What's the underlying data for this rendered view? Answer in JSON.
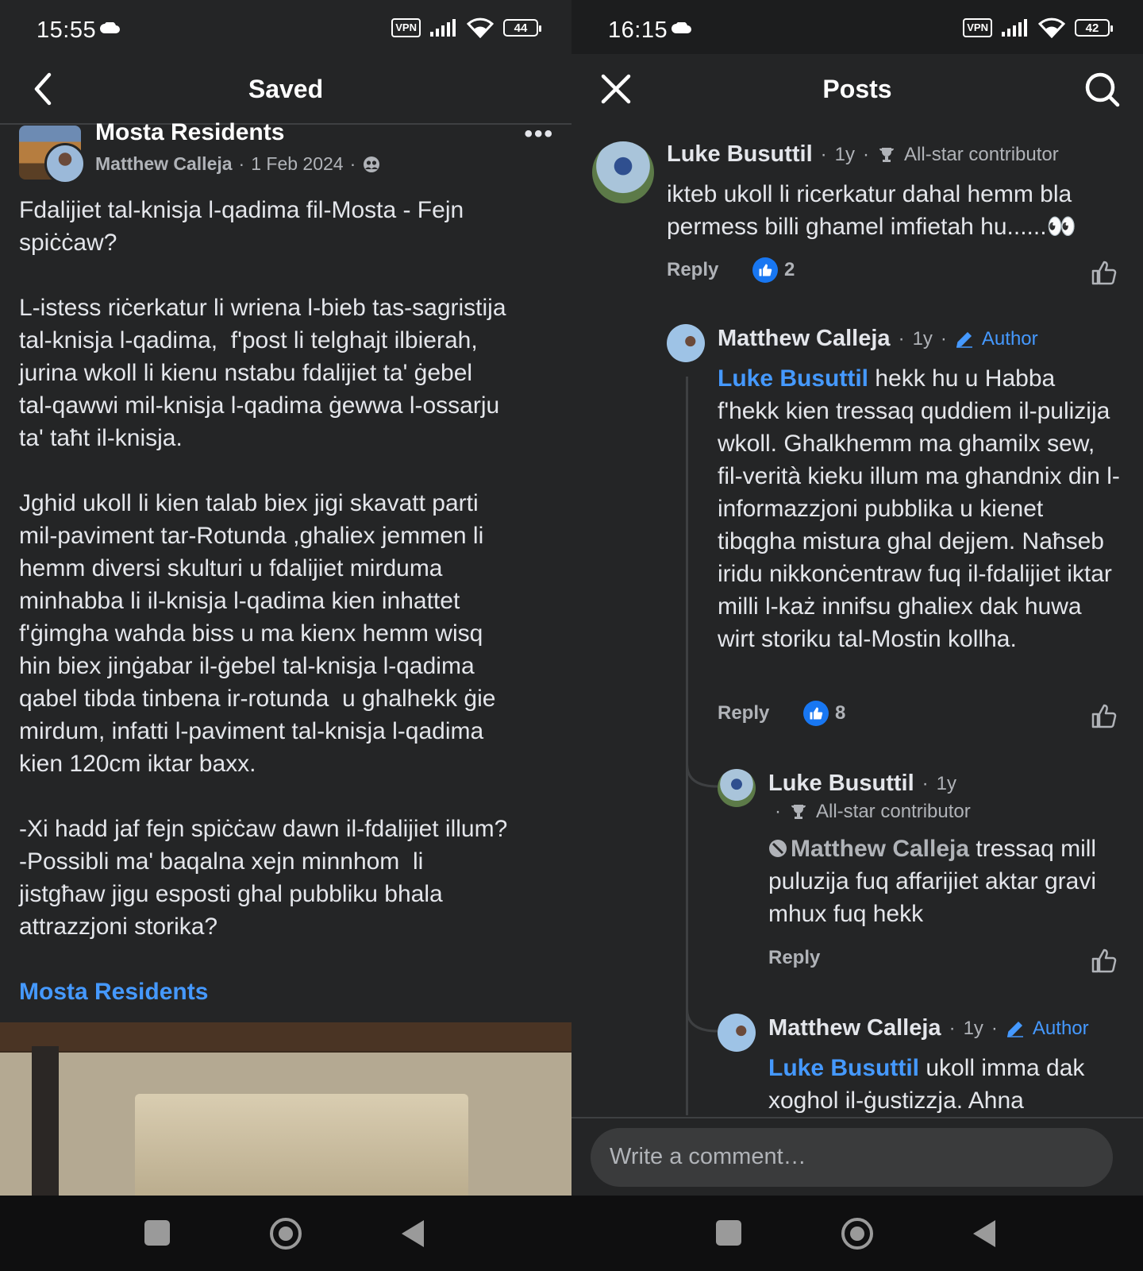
{
  "left": {
    "status": {
      "time": "15:55",
      "vpn": "VPN",
      "battery": "44"
    },
    "header": {
      "title": "Saved"
    },
    "post": {
      "group": "Mosta Residents",
      "author": "Matthew Calleja",
      "date": "1 Feb 2024",
      "sep": "·",
      "body": "Fdalijiet tal-knisja l-qadima fil-Mosta - Fejn\nspiċċaw?\n\nL-istess riċerkatur li wriena l-bieb tas-sagristija\ntal-knisja l-qadima,  f'post li telghajt ilbierah,\njurina wkoll li kienu nstabu fdalijiet ta' ġebel\ntal-qawwi mil-knisja l-qadima ġewwa l-ossarju\nta' taħt il-knisja.\n\nJghid ukoll li kien talab biex jigi skavatt parti\nmil-paviment tar-Rotunda ,ghaliex jemmen li\nhemm diversi skulturi u fdalijiet mirduma\nminhabba li il-knisja l-qadima kien inhattet\nf'ġimgha wahda biss u ma kienx hemm wisq\nhin biex jinġabar il-ġebel tal-knisja l-qadima\nqabel tibda tinbena ir-rotunda  u ghalhekk ġie\nmirdum, infatti l-paviment tal-knisja l-qadima\nkien 120cm iktar baxx.\n\n-Xi hadd jaf fejn spiċċaw dawn il-fdalijiet illum?\n-Possibli ma' baqalna xejn minnhom  li\njistgħaw jigu esposti ghal pubbliku bhala\nattrazzjoni storika?",
      "group_link": "Mosta Residents"
    }
  },
  "right": {
    "status": {
      "time": "16:15",
      "vpn": "VPN",
      "battery": "42"
    },
    "header": {
      "title": "Posts"
    },
    "comments": [
      {
        "name": "Luke Busuttil",
        "age": "1y",
        "badge": "All-star contributor",
        "text": "ikteb ukoll li ricerkatur dahal hemm bla permess billi ghamel imfietah hu......👀",
        "reply": "Reply",
        "likes": "2"
      },
      {
        "name": "Matthew Calleja",
        "age": "1y",
        "badge": "Author",
        "mention": "Luke Busuttil",
        "text": " hekk hu u Habba f'hekk kien tressaq quddiem il-pulizija wkoll. Ghalkhemm ma ghamilx sew, fil-verità kieku illum ma ghandnix din l-informazzjoni pubblika u kienet tibqgha mistura ghal dejjem. Naħseb iridu nikkonċentraw fuq il-fdalijiet iktar milli l-każ innifsu ghaliex dak huwa wirt storiku tal-Mostin kollha.",
        "reply": "Reply",
        "likes": "8"
      },
      {
        "name": "Luke Busuttil",
        "age": "1y",
        "badge": "All-star contributor",
        "mention": "Matthew Calleja",
        "text": " tressaq mill puluzija fuq affarijiet aktar gravi mhux fuq hekk",
        "reply": "Reply"
      },
      {
        "name": "Matthew Calleja",
        "age": "1y",
        "badge": "Author",
        "mention": "Luke Busuttil",
        "text": " ukoll imma dak xoghol il-ġustizzja. Ahna"
      }
    ],
    "composer": {
      "placeholder": "Write a comment…"
    }
  }
}
